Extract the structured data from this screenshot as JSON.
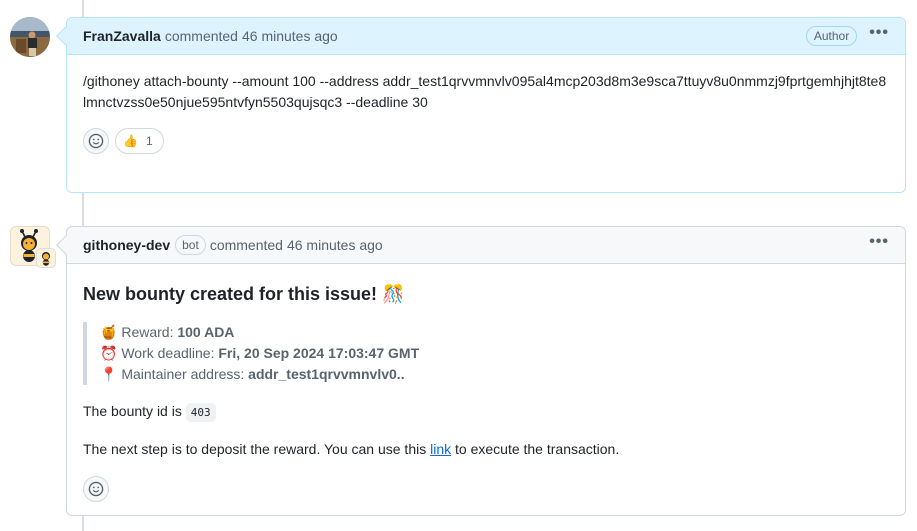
{
  "comments": [
    {
      "username": "FranZavalla",
      "action": "commented",
      "time": "46 minutes ago",
      "role_badge": "Author",
      "more_icon": "kebab-horizontal-icon",
      "body_text": "/githoney attach-bounty --amount 100 --address addr_test1qrvvmnvlv095al4mcp203d8m3e9sca7ttuyv8u0nmmzj9fprtgemhjhjt8te8lmnctvzss0e50njue595ntvfyn5503qujsqc3 --deadline 30",
      "reactions": [
        {
          "emoji": "👍",
          "name": "thumbs-up",
          "count": "1"
        }
      ],
      "colors": {
        "header_bg": "#ddf4ff",
        "border": "#b6e3ff"
      }
    },
    {
      "username": "githoney-dev",
      "bot_badge": "bot",
      "action": "commented",
      "time": "46 minutes ago",
      "more_icon": "kebab-horizontal-icon",
      "title": "New bounty created for this issue! 🎊",
      "details": [
        {
          "emoji": "🍯",
          "label": "Reward:",
          "value": "100 ADA"
        },
        {
          "emoji": "⏰",
          "label": "Work deadline:",
          "value": "Fri, 20 Sep 2024 17:03:47 GMT"
        },
        {
          "emoji": "📍",
          "label": "Maintainer address:",
          "value": "addr_test1qrvvmnvlv0.."
        }
      ],
      "bounty_id_prefix": "The bounty id is",
      "bounty_id": "403",
      "next_step_before": "The next step is to deposit the reward. You can use this",
      "next_step_link": "link",
      "next_step_after": "to execute the transaction.",
      "colors": {
        "header_bg": "#f6f8fa",
        "border": "#d0d7de",
        "link": "#0969da"
      }
    }
  ]
}
